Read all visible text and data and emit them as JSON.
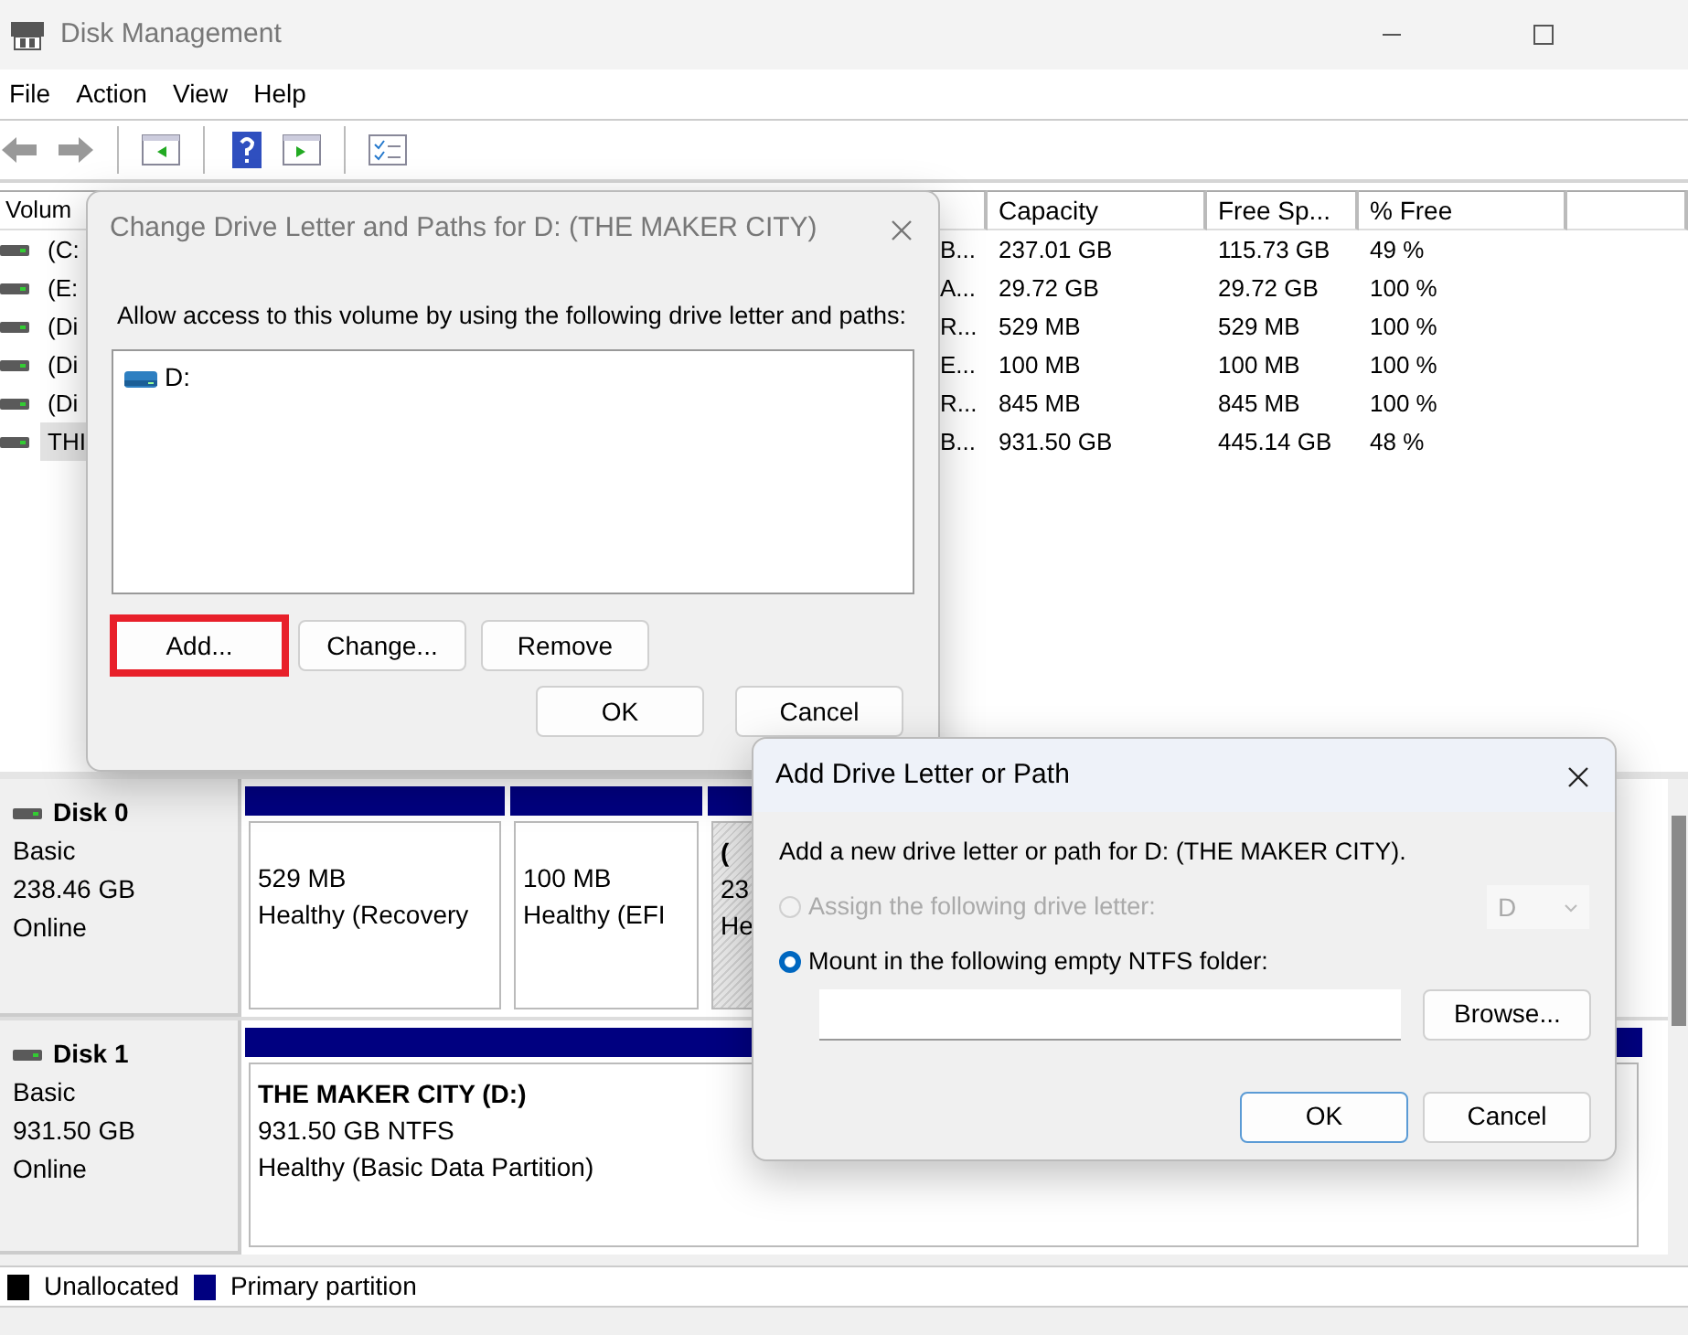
{
  "window": {
    "title": "Disk Management"
  },
  "menu": [
    "File",
    "Action",
    "View",
    "Help"
  ],
  "volume_list": {
    "columns": [
      "Volum",
      "Capacity",
      "Free Sp...",
      "% Free"
    ],
    "rows": [
      {
        "volume": "(C:",
        "status": "B...",
        "capacity": "237.01 GB",
        "free": "115.73 GB",
        "percent": "49 %",
        "selected": false
      },
      {
        "volume": "(E:",
        "status": "A...",
        "capacity": "29.72 GB",
        "free": "29.72 GB",
        "percent": "100 %",
        "selected": false
      },
      {
        "volume": "(Di",
        "status": "R...",
        "capacity": "529 MB",
        "free": "529 MB",
        "percent": "100 %",
        "selected": false
      },
      {
        "volume": "(Di",
        "status": "E...",
        "capacity": "100 MB",
        "free": "100 MB",
        "percent": "100 %",
        "selected": false
      },
      {
        "volume": "(Di",
        "status": "R...",
        "capacity": "845 MB",
        "free": "845 MB",
        "percent": "100 %",
        "selected": false
      },
      {
        "volume": "THI",
        "status": "B...",
        "capacity": "931.50 GB",
        "free": "445.14 GB",
        "percent": "48 %",
        "selected": true
      }
    ]
  },
  "disks": [
    {
      "name": "Disk 0",
      "type": "Basic",
      "size": "238.46 GB",
      "status": "Online",
      "partitions": [
        {
          "kind": "primary",
          "lines": [
            "529 MB",
            "Healthy (Recovery"
          ]
        },
        {
          "kind": "primary",
          "lines": [
            "100 MB",
            "Healthy (EFI"
          ]
        },
        {
          "kind": "hatched",
          "title": "(",
          "lines": [
            "23",
            "He"
          ]
        }
      ]
    },
    {
      "name": "Disk 1",
      "type": "Basic",
      "size": "931.50 GB",
      "status": "Online",
      "partitions": [
        {
          "kind": "primary",
          "title": "THE MAKER CITY  (D:)",
          "lines": [
            "931.50 GB NTFS",
            "Healthy (Basic Data Partition)"
          ]
        }
      ]
    }
  ],
  "legend": [
    {
      "label": "Unallocated",
      "color": "#000000"
    },
    {
      "label": "Primary partition",
      "color": "#000080"
    }
  ],
  "change_dialog": {
    "title": "Change Drive Letter and Paths for D: (THE MAKER CITY)",
    "prompt": "Allow access to this volume by using the following drive letter and paths:",
    "paths": [
      "D:"
    ],
    "buttons": [
      {
        "label": "Add...",
        "highlighted": true
      },
      {
        "label": "Change...",
        "highlighted": false
      },
      {
        "label": "Remove",
        "highlighted": false
      }
    ],
    "footer": [
      "OK",
      "Cancel"
    ]
  },
  "add_dialog": {
    "title": "Add Drive Letter or Path",
    "prompt": "Add a new drive letter or path for D: (THE MAKER CITY).",
    "options": [
      {
        "label": "Assign the following drive letter:",
        "selected": false,
        "disabled": true
      },
      {
        "label": "Mount in the following empty NTFS folder:",
        "selected": true,
        "disabled": false
      }
    ],
    "drive_letter": {
      "value": "D",
      "disabled": true
    },
    "browse": "Browse...",
    "footer": [
      {
        "label": "OK",
        "default": true
      },
      {
        "label": "Cancel",
        "default": false
      }
    ]
  }
}
